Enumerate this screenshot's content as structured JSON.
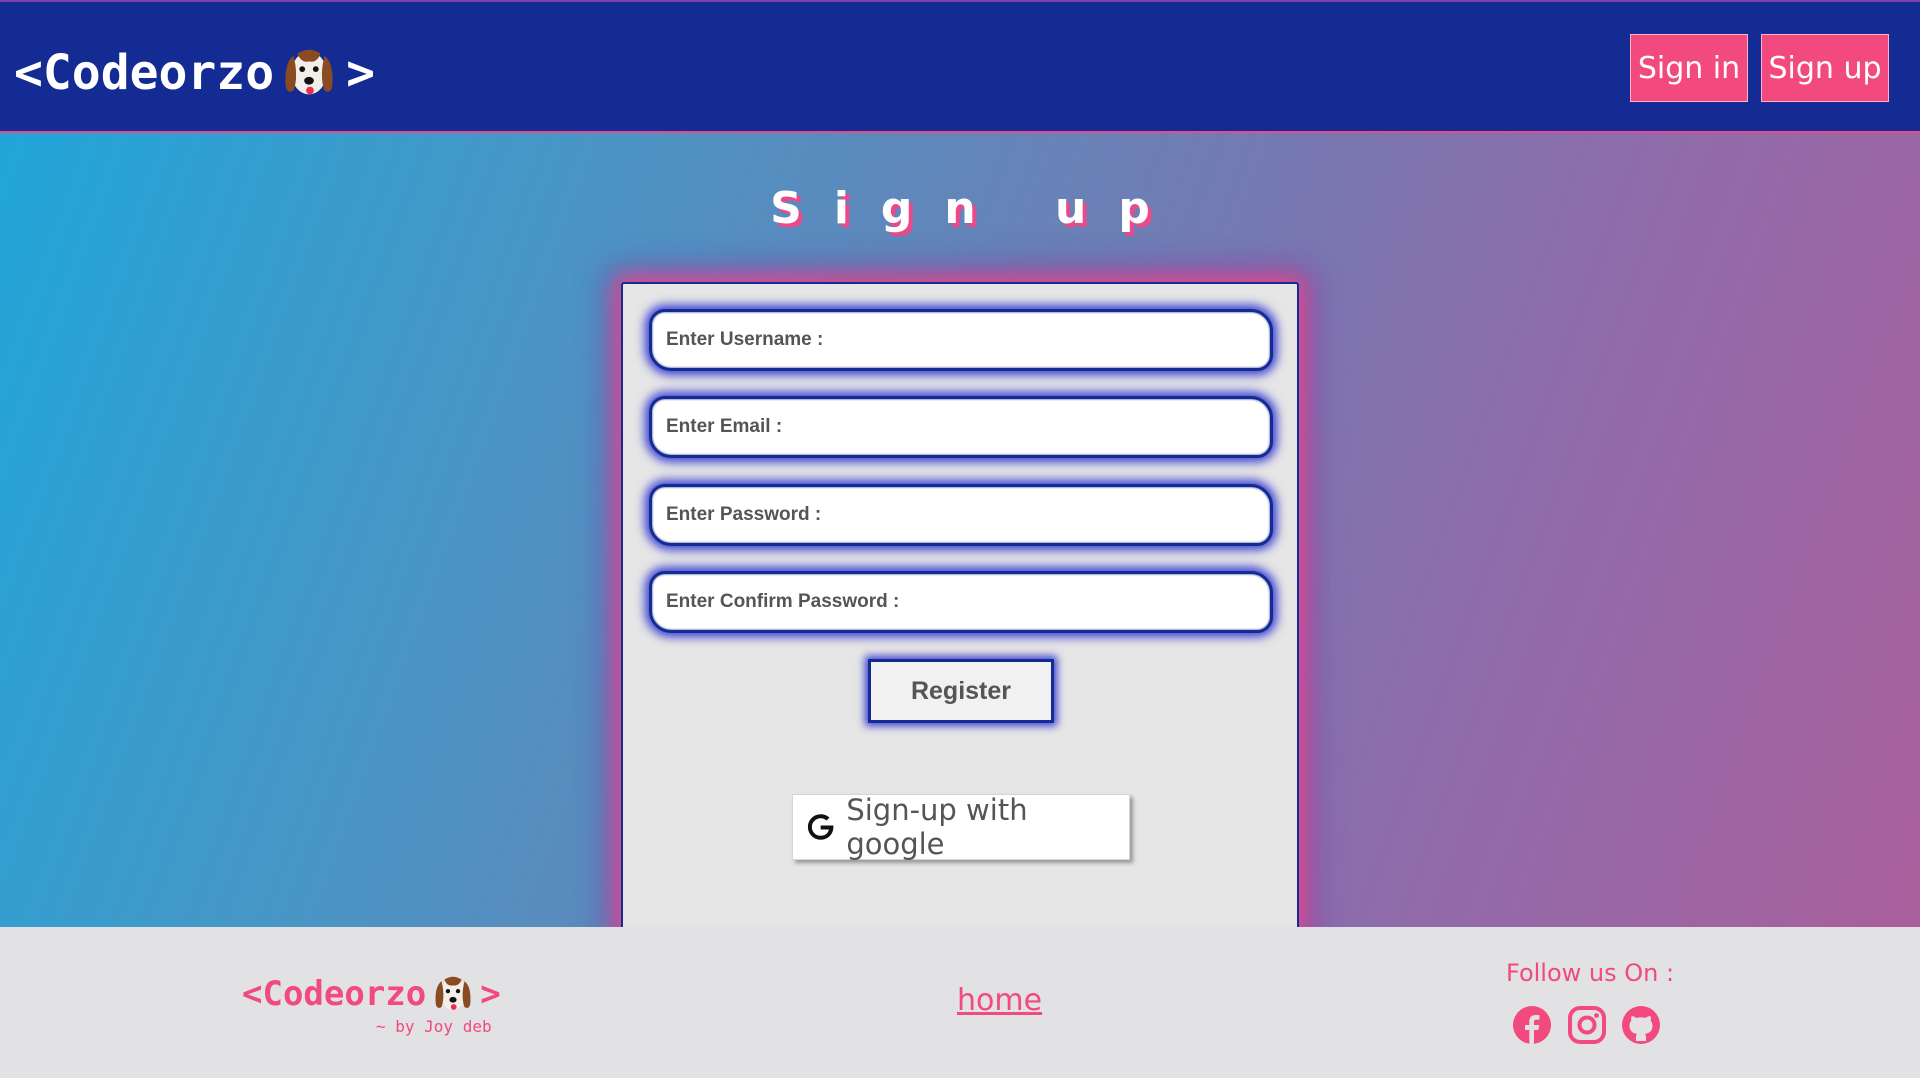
{
  "header": {
    "brand_left": "<Codeorzo",
    "brand_right": ">",
    "signin_label": "Sign in",
    "signup_label": "Sign up"
  },
  "page": {
    "title": "Sign up"
  },
  "form": {
    "username_placeholder": "Enter Username :",
    "email_placeholder": "Enter Email :",
    "password_placeholder": "Enter Password :",
    "confirm_placeholder": "Enter Confirm Password :",
    "register_label": "Register",
    "google_label": "Sign-up with google"
  },
  "footer": {
    "brand_left": "<Codeorzo",
    "brand_right": ">",
    "byline": "~ by Joy deb",
    "home_link": "home",
    "follow_label": "Follow us On :",
    "social_icons": [
      "facebook-icon",
      "instagram-icon",
      "github-icon"
    ]
  },
  "colors": {
    "header_bg": "#132b92",
    "accent_pink": "#f2497f",
    "card_bg": "#e6e6e6"
  }
}
